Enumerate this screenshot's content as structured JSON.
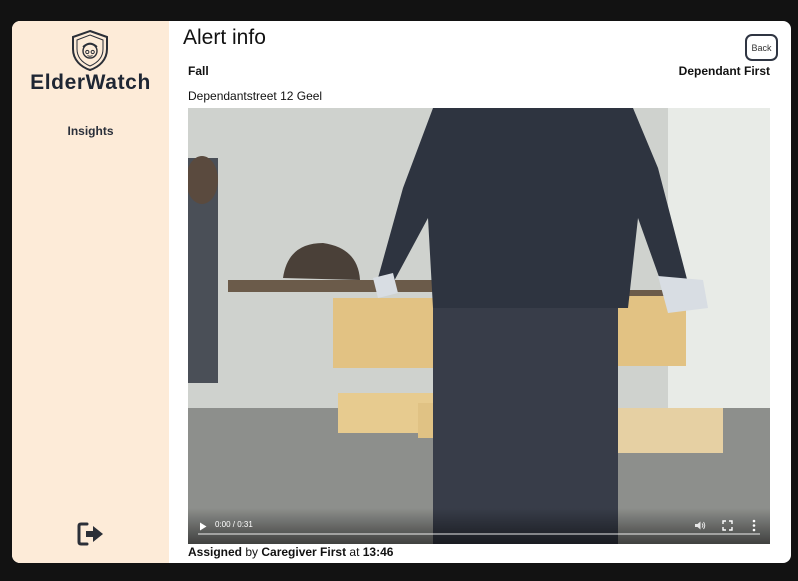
{
  "sidebar": {
    "brand": "ElderWatch",
    "logo_icon": "shield-face-icon",
    "nav_items": [
      {
        "label": "Insights"
      }
    ],
    "logout_icon": "logout-icon"
  },
  "alert": {
    "title": "Alert info",
    "back_label": "Back",
    "type": "Fall",
    "dependant": "Dependant First",
    "address": "Dependantstreet 12 Geel"
  },
  "video": {
    "current_time": "0:00",
    "duration": "0:31",
    "separator": " / ",
    "progress": 0.0
  },
  "assignment": {
    "prefix": "Assigned",
    "by_word": " by ",
    "caregiver": "Caregiver First",
    "at_word": " at ",
    "time": "13:46"
  },
  "colors": {
    "sidebar_bg": "#fdebd8",
    "brand_text": "#1f2633",
    "backdrop": "#121212"
  }
}
